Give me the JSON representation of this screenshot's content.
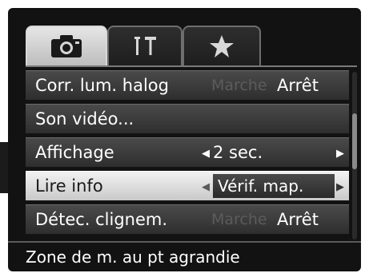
{
  "tabs": [
    {
      "name": "shooting",
      "icon": "camera-icon",
      "active": true
    },
    {
      "name": "setup",
      "icon": "wrench-hammer-icon",
      "active": false
    },
    {
      "name": "my-menu",
      "icon": "star-icon",
      "active": false
    }
  ],
  "menu": {
    "items": [
      {
        "label": "Corr. lum. halog",
        "option_dim": "Marche",
        "option": "Arrêt"
      },
      {
        "label": "Son vidéo..."
      },
      {
        "label": "Affichage",
        "value": "2 sec."
      },
      {
        "label": "Lire info",
        "value": "Vérif. map.",
        "selected": true
      },
      {
        "label": "Détec. clignem.",
        "option_dim": "Marche",
        "option": "Arrêt"
      }
    ]
  },
  "scroll": {
    "position_fraction": 0.3
  },
  "footer": {
    "hint": "Zone de m. au pt agrandie"
  },
  "colors": {
    "background": "#121212",
    "row": "#3a3a3a",
    "selected_row": "#e0e0e0",
    "text": "#ffffff",
    "dim_text": "#5c5c5c"
  }
}
